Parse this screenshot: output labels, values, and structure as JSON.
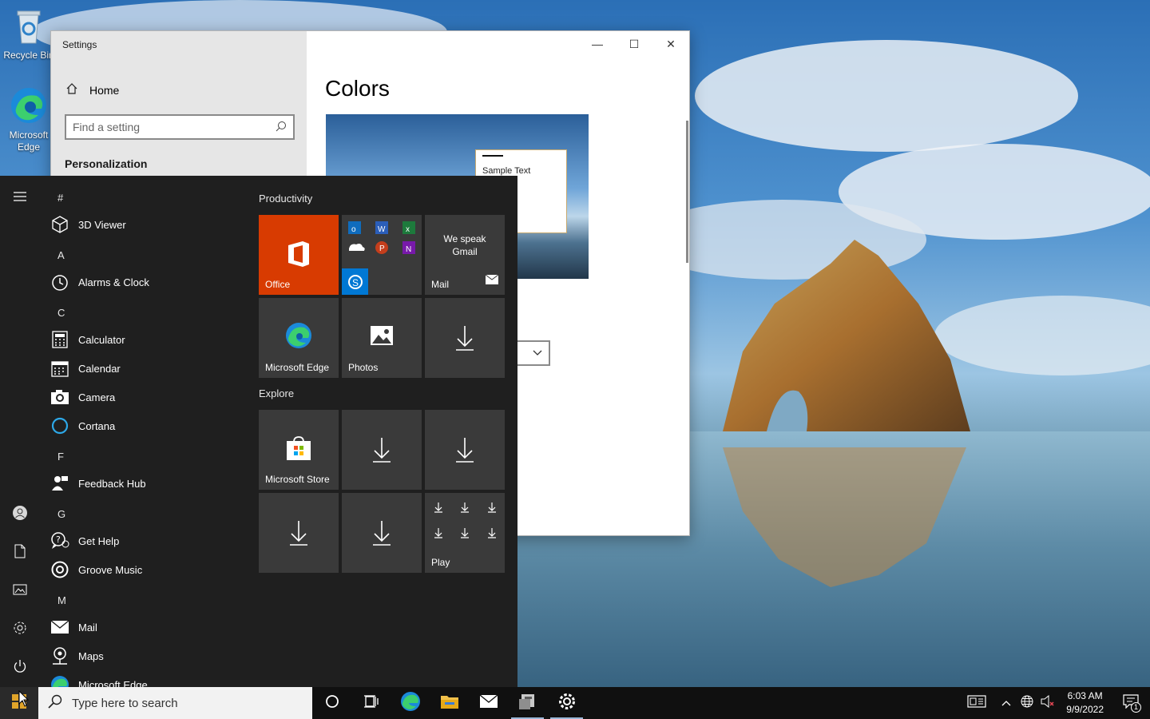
{
  "desktop": {
    "icons": [
      {
        "label": "Recycle Bin",
        "icon": "recycle-bin-icon"
      },
      {
        "label": "Microsoft Edge",
        "icon": "edge-icon"
      }
    ]
  },
  "settings_window": {
    "title": "Settings",
    "home_label": "Home",
    "search_placeholder": "Find a setting",
    "section": "Personalization",
    "page_title": "Colors",
    "preview_sample_text": "Sample Text",
    "controls": {
      "minimize": "minimize-icon",
      "maximize": "maximize-icon",
      "close": "close-icon"
    }
  },
  "start_menu": {
    "rail": [
      "hamburger-icon",
      "user-icon",
      "documents-icon",
      "pictures-icon",
      "gear-icon",
      "power-icon"
    ],
    "app_list": [
      {
        "letter": "#"
      },
      {
        "app": "3D Viewer",
        "icon": "cube-icon"
      },
      {
        "letter": "A"
      },
      {
        "app": "Alarms & Clock",
        "icon": "clock-icon"
      },
      {
        "letter": "C"
      },
      {
        "app": "Calculator",
        "icon": "calculator-icon"
      },
      {
        "app": "Calendar",
        "icon": "calendar-icon"
      },
      {
        "app": "Camera",
        "icon": "camera-icon"
      },
      {
        "app": "Cortana",
        "icon": "cortana-icon"
      },
      {
        "letter": "F"
      },
      {
        "app": "Feedback Hub",
        "icon": "feedback-icon"
      },
      {
        "letter": "G"
      },
      {
        "app": "Get Help",
        "icon": "help-icon"
      },
      {
        "app": "Groove Music",
        "icon": "music-icon"
      },
      {
        "letter": "M"
      },
      {
        "app": "Mail",
        "icon": "mail-icon"
      },
      {
        "app": "Maps",
        "icon": "maps-icon"
      },
      {
        "app": "Microsoft Edge",
        "icon": "edge-icon"
      }
    ],
    "groups": [
      {
        "title": "Productivity",
        "tiles": [
          {
            "label": "Office",
            "icon": "office-icon",
            "color": "#d83b01"
          },
          {
            "label": "",
            "icon": "office-apps-folder-icon"
          },
          {
            "label": "Mail",
            "icon": "mail-icon",
            "text": "We speak Gmail"
          },
          {
            "label": "Microsoft Edge",
            "icon": "edge-icon"
          },
          {
            "label": "Photos",
            "icon": "photos-icon"
          },
          {
            "label": "",
            "icon": "download-icon"
          }
        ]
      },
      {
        "title": "Explore",
        "tiles": [
          {
            "label": "Microsoft Store",
            "icon": "store-icon"
          },
          {
            "label": "",
            "icon": "download-icon"
          },
          {
            "label": "",
            "icon": "download-icon"
          },
          {
            "label": "",
            "icon": "download-icon"
          },
          {
            "label": "",
            "icon": "download-icon"
          },
          {
            "label": "Play",
            "icon": "download-folder-icon"
          }
        ]
      }
    ]
  },
  "taskbar": {
    "search_placeholder": "Type here to search",
    "pinned": [
      "cortana-icon",
      "task-view-icon",
      "edge-icon",
      "file-explorer-icon",
      "mail-icon",
      "app-icon",
      "settings-icon"
    ],
    "tray": [
      "news-icon",
      "chevron-up-icon",
      "network-icon",
      "volume-muted-icon"
    ],
    "time": "6:03 AM",
    "date": "9/9/2022",
    "notification_count": "1"
  },
  "colors": {
    "accent": "#d83b01",
    "start_bg": "#1f1f1f",
    "taskbar_bg": "#101010",
    "tile_bg": "#3a3a3a"
  }
}
